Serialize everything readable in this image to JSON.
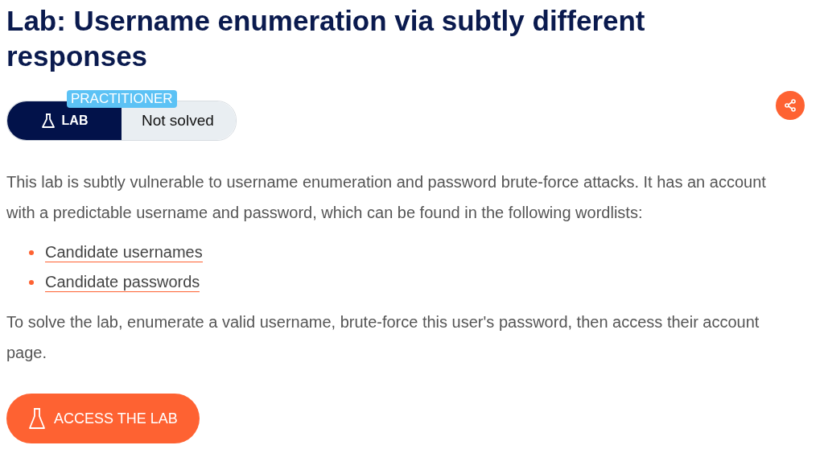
{
  "title": "Lab: Username enumeration via subtly different responses",
  "badge": {
    "level": "PRACTITIONER",
    "type": "LAB",
    "status": "Not solved"
  },
  "intro": "This lab is subtly vulnerable to username enumeration and password brute-force attacks. It has an account with a predictable username and password, which can be found in the following wordlists:",
  "links": [
    "Candidate usernames",
    "Candidate passwords"
  ],
  "task": "To solve the lab, enumerate a valid username, brute-force this user's password, then access their account page.",
  "button": "ACCESS THE LAB"
}
